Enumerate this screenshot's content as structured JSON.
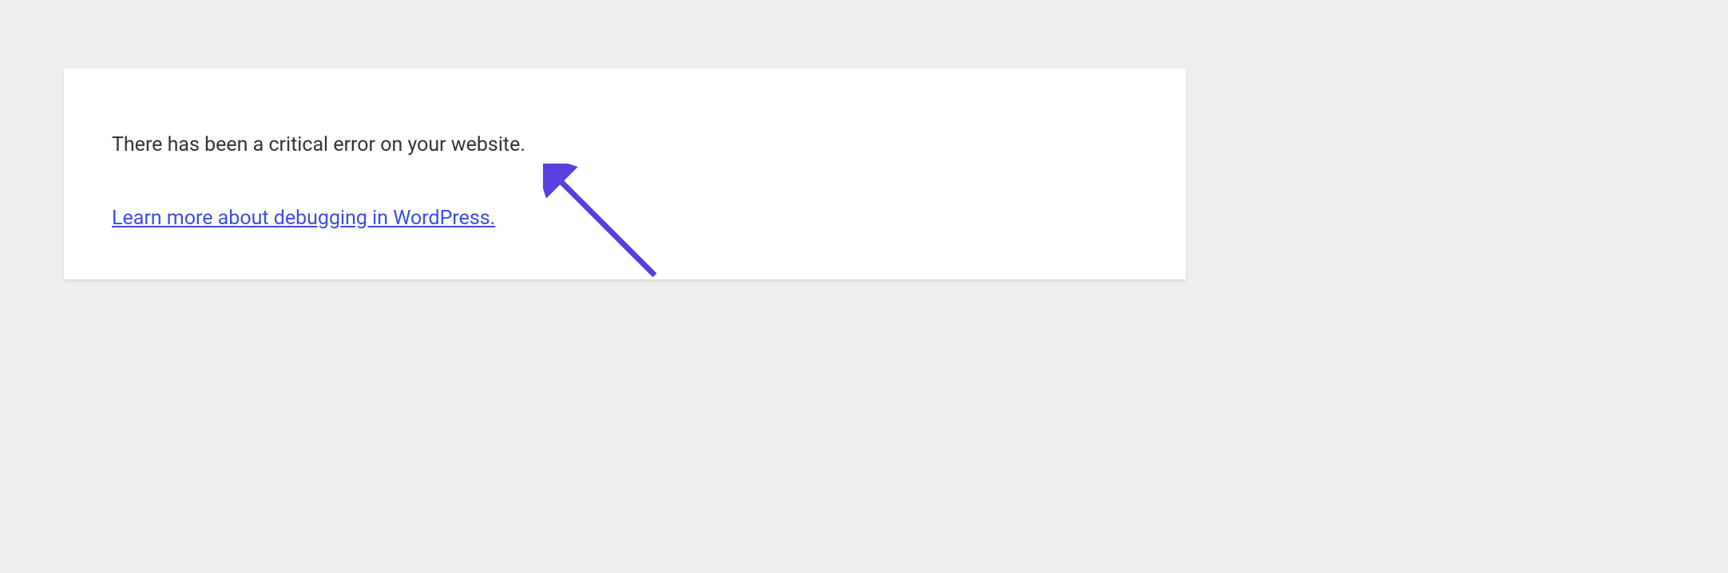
{
  "error": {
    "message": "There has been a critical error on your website.",
    "link_text": "Learn more about debugging in WordPress."
  },
  "annotation": {
    "arrow_color": "#5b3ee0"
  }
}
